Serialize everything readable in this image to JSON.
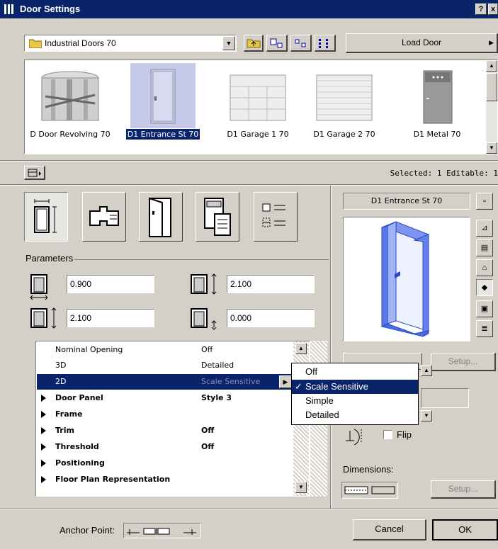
{
  "window": {
    "title": "Door Settings",
    "help": "?",
    "close": "x"
  },
  "library": {
    "folder": "Industrial Doors 70",
    "load_button": "Load Door"
  },
  "thumbnails": [
    {
      "label": "D Door Revolving 70"
    },
    {
      "label": "D1 Entrance St 70",
      "selected": true
    },
    {
      "label": "D1 Garage 1 70"
    },
    {
      "label": "D1 Garage 2 70"
    },
    {
      "label": "D1 Metal 70"
    }
  ],
  "status": {
    "selected_text": "Selected: 1 Editable: 1"
  },
  "parameters": {
    "group_label": "Parameters",
    "width": "0.900",
    "height": "2.100",
    "sill_height": "2.100",
    "offset": "0.000"
  },
  "param_list": [
    {
      "name": "Nominal Opening",
      "value": "Off",
      "expandable": false,
      "bold": false
    },
    {
      "name": "3D",
      "value": "Detailed",
      "expandable": false,
      "bold": false
    },
    {
      "name": "2D",
      "value": "Scale Sensitive",
      "expandable": false,
      "bold": false,
      "selected": true
    },
    {
      "name": "Door Panel",
      "value": "Style 3",
      "expandable": true,
      "bold": true
    },
    {
      "name": "Frame",
      "value": "",
      "expandable": true,
      "bold": true
    },
    {
      "name": "Trim",
      "value": "Off",
      "expandable": true,
      "bold": true
    },
    {
      "name": "Threshold",
      "value": "Off",
      "expandable": true,
      "bold": true
    },
    {
      "name": "Positioning",
      "value": "",
      "expandable": true,
      "bold": true
    },
    {
      "name": "Floor Plan Representation",
      "value": "",
      "expandable": true,
      "bold": true
    }
  ],
  "dropdown": {
    "options": [
      "Off",
      "Scale Sensitive",
      "Simple",
      "Detailed"
    ],
    "checked": "Scale Sensitive"
  },
  "preview": {
    "title": "D1 Entrance St 70",
    "setup_label": "Setup...",
    "flip_label": "Flip",
    "dimensions_label": "Dimensions:",
    "dim_setup_label": "Setup..."
  },
  "footer": {
    "anchor_label": "Anchor Point:",
    "cancel": "Cancel",
    "ok": "OK"
  },
  "colors": {
    "title_bg": "#0a246a",
    "selection": "#0a246a",
    "thumb_selected": "#c6cbe9",
    "door_blue": "#4a6ee6"
  }
}
